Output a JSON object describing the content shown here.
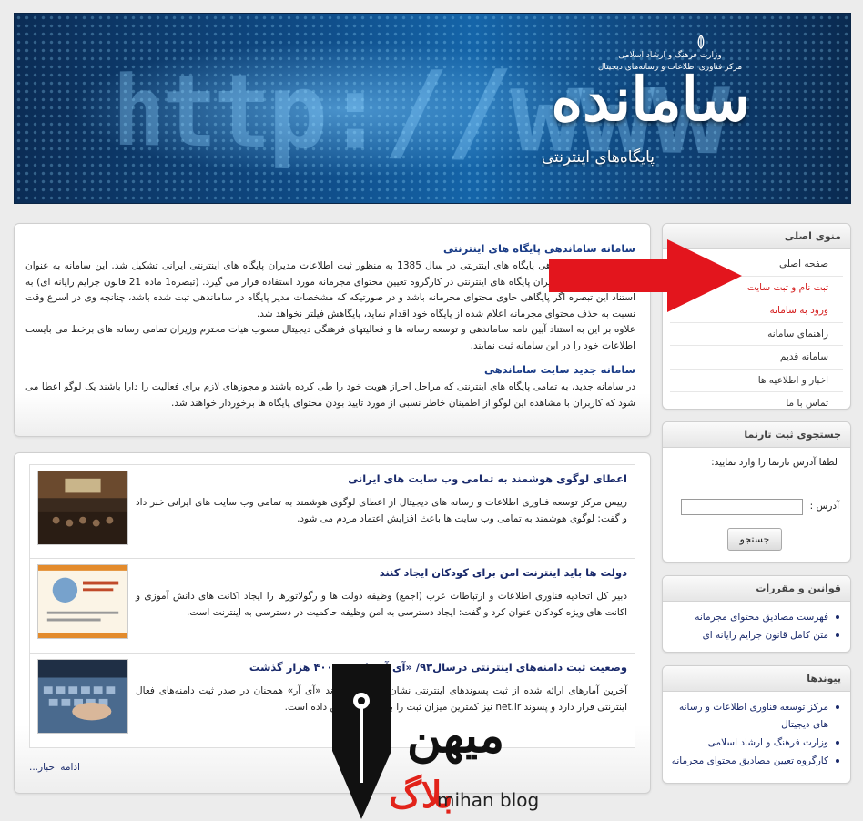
{
  "banner": {
    "brand": "سامانده",
    "subtitle": "پایگاه‌های اینترنتی",
    "ministry_line1": "وزارت فرهنگ و ارشاد اسلامی",
    "ministry_line2": "مرکز فناوری اطلاعات و رسانه‌های دیجیتال",
    "url_art": "http://www"
  },
  "intro": {
    "title": "سامانه ساماندهی پایگاه های اینترنتی",
    "paragraph": "سایت سامانه ساماندهی پایگاه های اینترنتی در سال 1385 به منظور ثبت اطلاعات مدیران پایگاه های اینترنتی ایرانی تشکیل شد. این سامانه به عنوان مرجع احراز هویت مدیران پایگاه های اینترنتی در کارگروه تعیین محتوای مجرمانه مورد استفاده قرار می گیرد. (تبصره1 ماده 21 قانون جرایم رایانه ای) به استناد این تبصره اگر پایگاهی حاوی محتوای مجرمانه باشد و در صورتیکه که مشخصات مدیر پایگاه در ساماندهی ثبت شده باشد، چنانچه وی در اسرع وقت نسبت به حذف محتوای مجرمانه اعلام شده از پایگاه خود اقدام نماید، پایگاهش فیلتر نخواهد شد.",
    "paragraph2": "علاوه بر این به استناد آیین نامه ساماندهی و توسعه رسانه ها و فعالیتهای فرهنگی دیجیتال مصوب هیات محترم وزیران تمامی رسانه های برخط می بایست اطلاعات خود را در این سامانه ثبت نمایند.",
    "title2": "سامانه جدید سایت ساماندهی",
    "paragraph3": "در سامانه جدید، به تمامی پایگاه های اینترنتی که مراحل احراز هویت خود را طی کرده باشند و مجوزهای لازم برای فعالیت را دارا باشند یک لوگو اعطا می شود که کاربران با مشاهده این لوگو از اطمینان خاطر نسبی از مورد تایید بودن محتوای پایگاه ها برخوردار خواهند شد."
  },
  "news": {
    "items": [
      {
        "title": "اعطای لوگوی هوشمند به تمامی وب سایت های ایرانی",
        "body": "رییس مرکز توسعه فناوری اطلاعات و رسانه های دیجیتال از اعطای لوگوی هوشمند به تمامی وب سایت های ایرانی خبر داد و گفت: لوگوی هوشمند به تمامی وب سایت ها باعث افزایش اعتماد مردم می شود."
      },
      {
        "title": "دولت ها باید اینترنت امن برای کودکان ایجاد کنند",
        "body": "دبیر کل اتحادیه فناوری اطلاعات و ارتباطات عرب (اجمع) وظیفه دولت ها و رگولاتورها را ایجاد اکانت های دانش آموزی و اکانت های ویژه کودکان عنوان کرد و گفت: ایجاد دسترسی به امن وظیفه حاکمیت در دسترسی به اینترنت است."
      },
      {
        "title": "وضعیت ثبت دامنه‌های اینترنتی درسال۹۳/ «آی آر» از مرز ۴۰۰ هزار گذشت",
        "body": "آخرین آمارهای ارائه شده از ثبت پسوندهای اینترنتی نشان می دهد پسوند «آی آر» همچنان در صدر ثبت دامنه‌های فعال اینترنتی قرار دارد و پسوند net.ir نیز کمترین میزان ثبت را به خود اختصاص داده است."
      }
    ],
    "more_label": "ادامه اخبار..."
  },
  "sidebar": {
    "menu_title": "منوی اصلی",
    "menu_items": [
      {
        "label": "صفحه اصلی",
        "red": false
      },
      {
        "label": "ثبت نام و ثبت سایت",
        "red": true
      },
      {
        "label": "ورود به سامانه",
        "red": true
      },
      {
        "label": "راهنمای سامانه",
        "red": false
      },
      {
        "label": "سامانه قدیم",
        "red": false
      },
      {
        "label": "اخبار و اطلاعیه ها",
        "red": false
      },
      {
        "label": "تماس با ما",
        "red": false
      }
    ],
    "search_title": "جستجوی ثبت تارنما",
    "search_prompt": "لطفا آدرس تارنما را وارد نمایید:",
    "address_label": "آدرس :",
    "address_value": "",
    "search_button": "جستجو",
    "laws_title": "قوانین و مقررات",
    "laws": [
      "فهرست مصادیق محتوای مجرمانه",
      "متن کامل قانون جرایم رایانه ای"
    ],
    "links_title": "پیوندها",
    "links": [
      "مرکز توسعه فناوری اطلاعات و رسانه های دیجیتال",
      "وزارت فرهنگ و ارشاد اسلامی",
      "کارگروه تعیین مصادیق محتوای مجرمانه"
    ]
  },
  "overlay": {
    "arrow_color": "#e3151d"
  },
  "watermark": {
    "fa": "میهن",
    "fa2": "بلاگ",
    "en": "mihan blog"
  }
}
